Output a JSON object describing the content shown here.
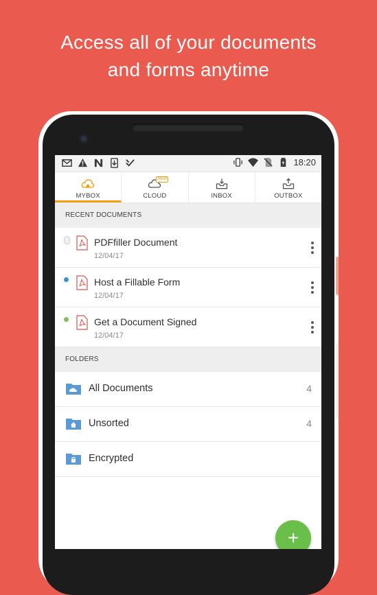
{
  "headline": {
    "line1": "Access all of your documents",
    "line2": "and forms anytime"
  },
  "statusbar": {
    "time": "18:20",
    "left_icons": [
      "gmail-icon",
      "warning-icon",
      "n-icon",
      "download-icon",
      "check-icon"
    ],
    "right_icons": [
      "vibrate-icon",
      "wifi-icon",
      "no-sim-icon",
      "battery-icon"
    ]
  },
  "tabs": [
    {
      "label": "MYBOX",
      "icon": "cloud-home-icon",
      "active": true
    },
    {
      "label": "CLOUD",
      "icon": "cloud-icon",
      "badge": "NEW"
    },
    {
      "label": "INBOX",
      "icon": "inbox-icon"
    },
    {
      "label": "OUTBOX",
      "icon": "outbox-icon"
    }
  ],
  "recent": {
    "header": "RECENT DOCUMENTS",
    "items": [
      {
        "title": "PDFfiller Document",
        "date": "12/04/17",
        "status_color": "#e0e0e0"
      },
      {
        "title": "Host a Fillable Form",
        "date": "12/04/17",
        "status_color": "#3d8fd8"
      },
      {
        "title": "Get a Document Signed",
        "date": "12/04/17",
        "status_color": "#7cc25a"
      }
    ]
  },
  "folders": {
    "header": "FOLDERS",
    "items": [
      {
        "name": "All Documents",
        "count": "4",
        "icon": "cloud-folder-icon"
      },
      {
        "name": "Unsorted",
        "count": "4",
        "icon": "home-folder-icon"
      },
      {
        "name": "Encrypted",
        "count": "",
        "icon": "lock-folder-icon"
      }
    ]
  },
  "fab": {
    "label": "+"
  },
  "colors": {
    "background": "#ea5a4f",
    "accent": "#f39c12",
    "folder_blue": "#5b9bd5",
    "fab_green": "#6abf4b"
  }
}
